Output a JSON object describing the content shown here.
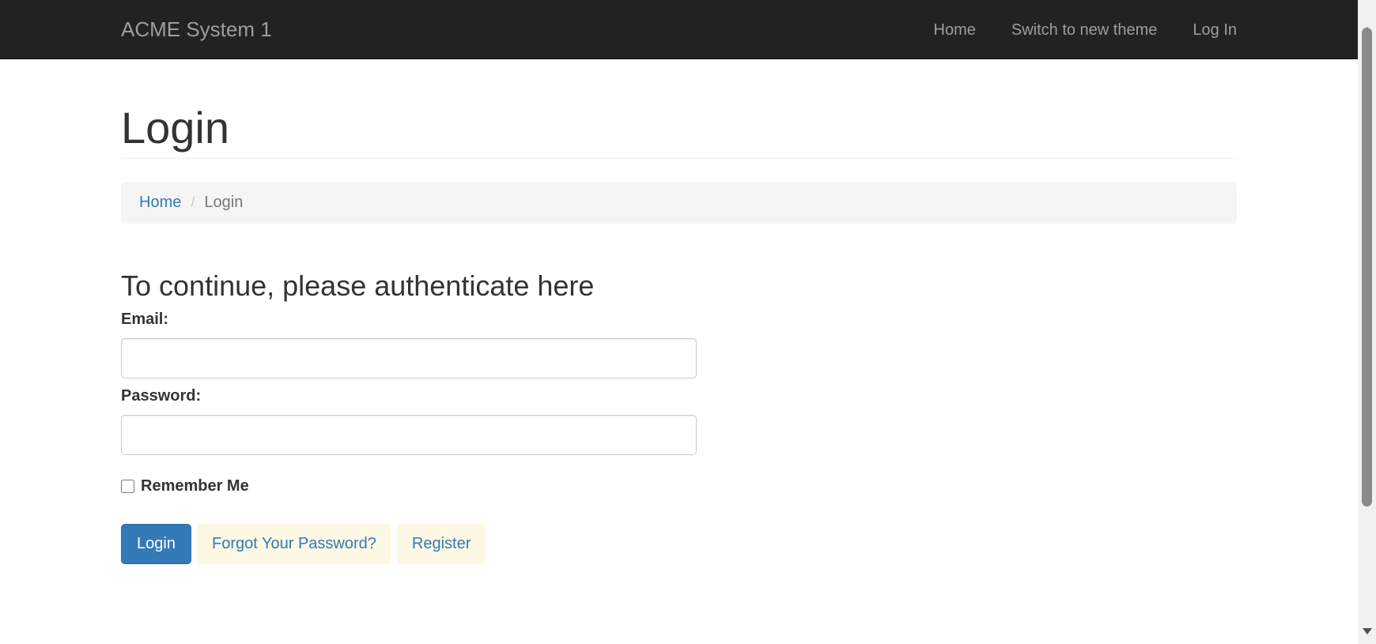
{
  "navbar": {
    "brand": "ACME System 1",
    "links": [
      {
        "label": "Home"
      },
      {
        "label": "Switch to new theme"
      },
      {
        "label": "Log In"
      }
    ]
  },
  "page": {
    "title": "Login",
    "breadcrumb": {
      "home": "Home",
      "separator": "/",
      "current": "Login"
    }
  },
  "form": {
    "heading": "To continue, please authenticate here",
    "email_label": "Email:",
    "email_value": "",
    "password_label": "Password:",
    "password_value": "",
    "remember_label": "Remember Me",
    "remember_checked": false,
    "login_button": "Login",
    "forgot_button": "Forgot Your Password?",
    "register_button": "Register"
  },
  "colors": {
    "navbar_bg": "#222222",
    "link": "#337ab7",
    "primary_button": "#337ab7",
    "link_button_bg": "#fcf8e3"
  }
}
